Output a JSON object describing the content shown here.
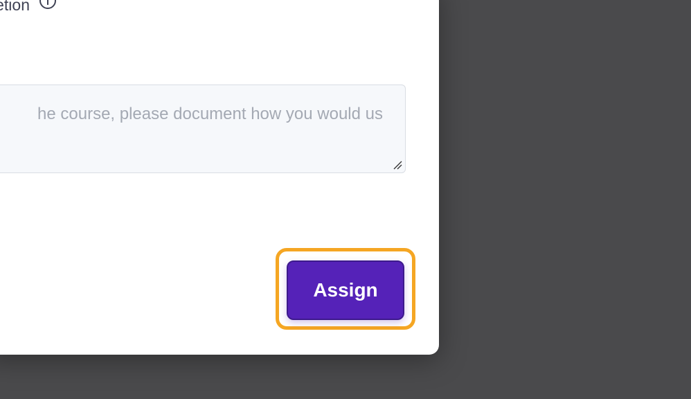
{
  "modal": {
    "field_label": "letion",
    "info_icon": "info-icon",
    "textarea": {
      "placeholder": "he course,  please document how you would us"
    },
    "assign_label": "Assign"
  },
  "colors": {
    "backdrop": "#4a4a4c",
    "modal_bg": "#ffffff",
    "textarea_bg": "#f6f8fb",
    "primary": "#5522b8",
    "focus_ring": "#f5a623",
    "label_text": "#3f4254",
    "placeholder_text": "#a4a9b3"
  }
}
